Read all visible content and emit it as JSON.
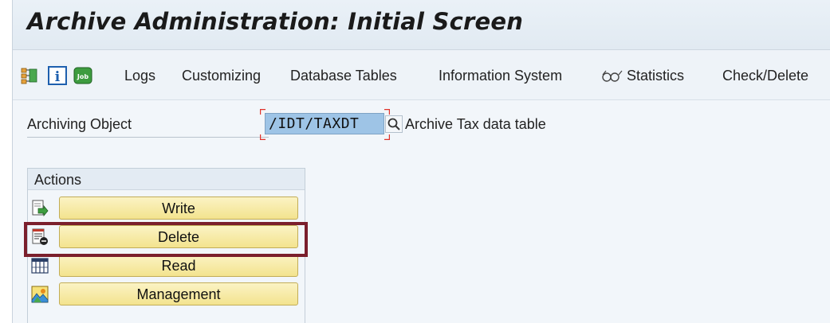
{
  "window": {
    "title": "Archive Administration: Initial Screen"
  },
  "toolbar": {
    "items": [
      {
        "icon": "org-structure-icon"
      },
      {
        "icon": "info-icon",
        "text": "i"
      },
      {
        "icon": "job-icon",
        "text": "Job"
      },
      {
        "label": "Logs"
      },
      {
        "label": "Customizing"
      },
      {
        "label": "Database Tables"
      },
      {
        "label": "Information System"
      },
      {
        "icon": "glasses-icon",
        "label": "Statistics"
      },
      {
        "label": "Check/Delete"
      }
    ]
  },
  "form": {
    "archiving_object_label": "Archiving Object",
    "archiving_object_value": "/IDT/TAXDT",
    "archiving_object_description": "Archive Tax data table"
  },
  "actions": {
    "title": "Actions",
    "buttons": [
      {
        "label": "Write",
        "icon": "write-icon"
      },
      {
        "label": "Delete",
        "icon": "delete-icon"
      },
      {
        "label": "Read",
        "icon": "read-icon"
      },
      {
        "label": "Management",
        "icon": "management-icon"
      }
    ]
  },
  "colors": {
    "highlight": "#7b1f2c",
    "button_fill": "#f3e38e",
    "input_fill": "#9ec4e6",
    "focus_marker": "#e0322a"
  }
}
